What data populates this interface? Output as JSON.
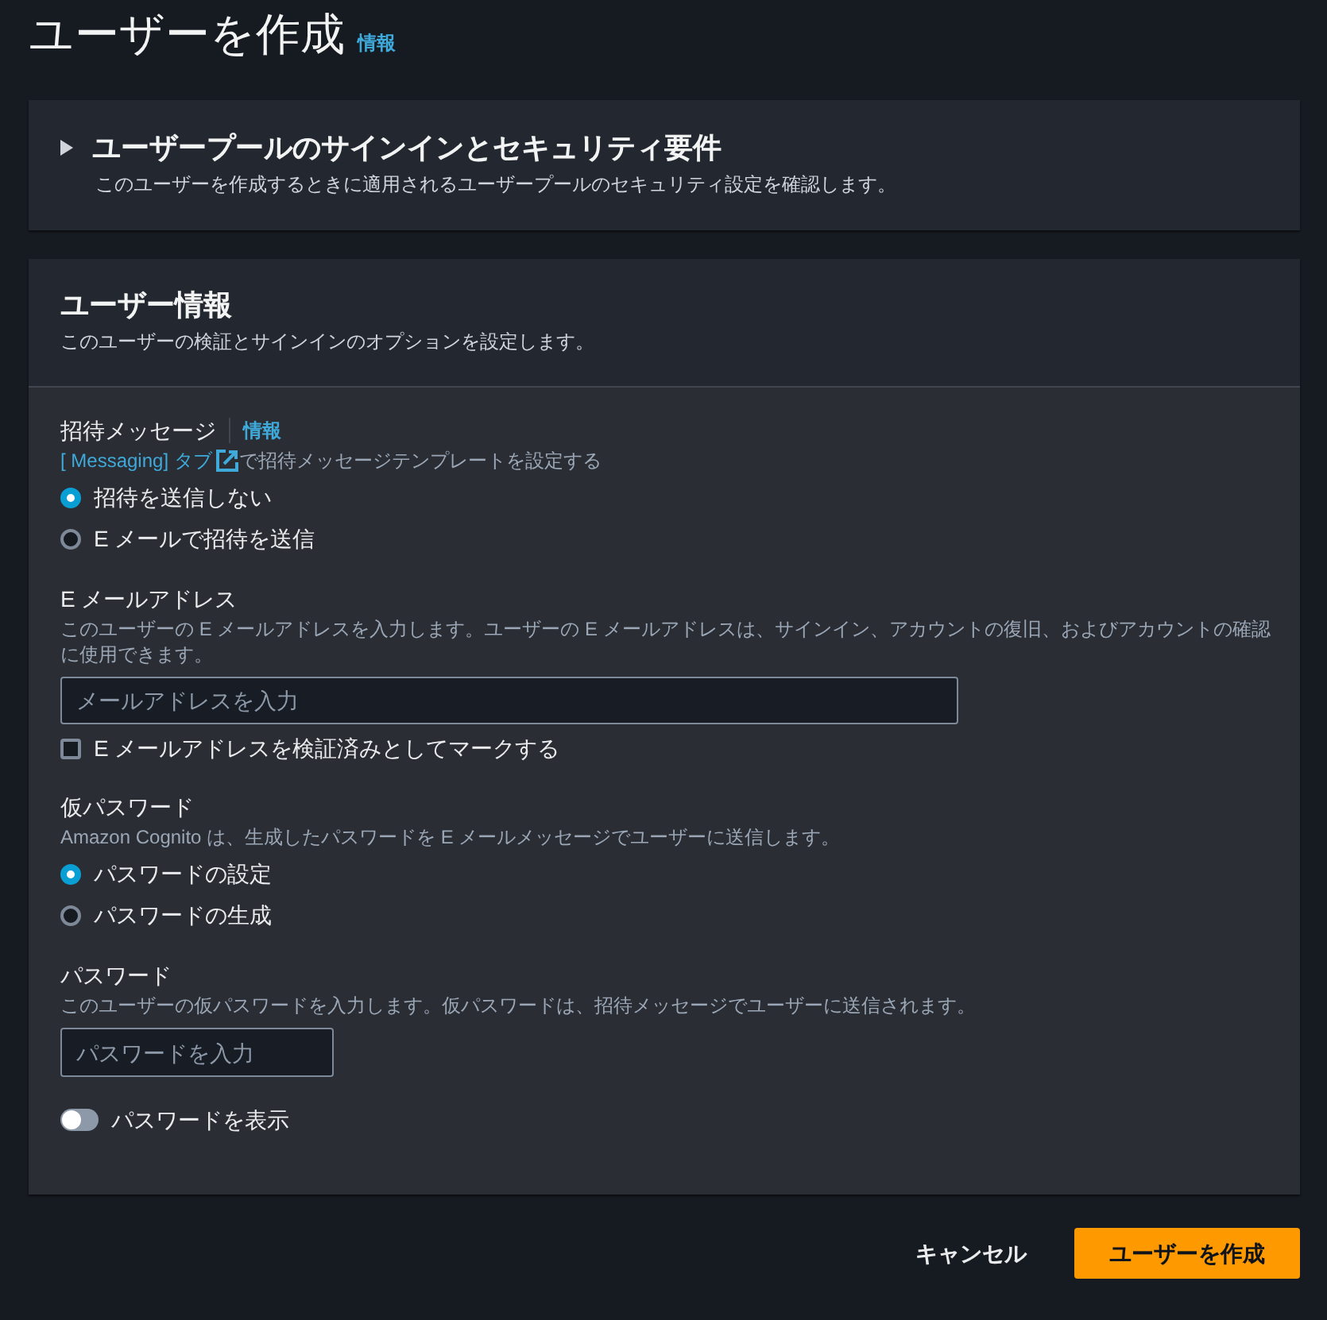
{
  "header": {
    "title": "ユーザーを作成",
    "info_link": "情報"
  },
  "security_panel": {
    "expanded": false,
    "title": "ユーザープールのサインインとセキュリティ要件",
    "description": "このユーザーを作成するときに適用されるユーザープールのセキュリティ設定を確認します。"
  },
  "user_info_panel": {
    "title": "ユーザー情報",
    "description": "このユーザーの検証とサインインのオプションを設定します。",
    "fields": [
      {
        "kind": "radio_group",
        "label": "招待メッセージ",
        "info_link": "情報",
        "hint_link": "[ Messaging] タブ",
        "hint_text": "で招待メッセージテンプレートを設定する",
        "options": [
          {
            "label": "招待を送信しない",
            "selected": true
          },
          {
            "label": "E メールで招待を送信",
            "selected": false
          }
        ]
      },
      {
        "kind": "email_input",
        "label": "E メールアドレス",
        "description": "このユーザーの E メールアドレスを入力します。ユーザーの E メールアドレスは、サインイン、アカウントの復旧、およびアカウントの確認に使用できます。",
        "placeholder": "メールアドレスを入力",
        "checkbox": {
          "label": "E メールアドレスを検証済みとしてマークする",
          "checked": false
        }
      },
      {
        "kind": "radio_group",
        "label": "仮パスワード",
        "description": "Amazon Cognito は、生成したパスワードを E メールメッセージでユーザーに送信します。",
        "options": [
          {
            "label": "パスワードの設定",
            "selected": true
          },
          {
            "label": "パスワードの生成",
            "selected": false
          }
        ]
      },
      {
        "kind": "password_input",
        "label": "パスワード",
        "description": "このユーザーの仮パスワードを入力します。仮パスワードは、招待メッセージでユーザーに送信されます。",
        "placeholder": "パスワードを入力",
        "toggle": {
          "label": "パスワードを表示",
          "on": false
        }
      }
    ]
  },
  "footer": {
    "buttons": [
      {
        "label": "キャンセル",
        "kind": "link"
      },
      {
        "label": "ユーザーを作成",
        "kind": "primary"
      }
    ]
  }
}
